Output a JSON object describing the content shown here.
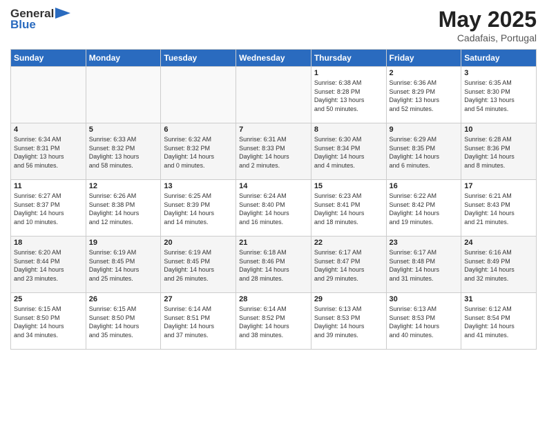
{
  "logo": {
    "general": "General",
    "blue": "Blue"
  },
  "title": "May 2025",
  "subtitle": "Cadafais, Portugal",
  "weekdays": [
    "Sunday",
    "Monday",
    "Tuesday",
    "Wednesday",
    "Thursday",
    "Friday",
    "Saturday"
  ],
  "weeks": [
    [
      {
        "day": "",
        "info": ""
      },
      {
        "day": "",
        "info": ""
      },
      {
        "day": "",
        "info": ""
      },
      {
        "day": "",
        "info": ""
      },
      {
        "day": "1",
        "info": "Sunrise: 6:38 AM\nSunset: 8:28 PM\nDaylight: 13 hours\nand 50 minutes."
      },
      {
        "day": "2",
        "info": "Sunrise: 6:36 AM\nSunset: 8:29 PM\nDaylight: 13 hours\nand 52 minutes."
      },
      {
        "day": "3",
        "info": "Sunrise: 6:35 AM\nSunset: 8:30 PM\nDaylight: 13 hours\nand 54 minutes."
      }
    ],
    [
      {
        "day": "4",
        "info": "Sunrise: 6:34 AM\nSunset: 8:31 PM\nDaylight: 13 hours\nand 56 minutes."
      },
      {
        "day": "5",
        "info": "Sunrise: 6:33 AM\nSunset: 8:32 PM\nDaylight: 13 hours\nand 58 minutes."
      },
      {
        "day": "6",
        "info": "Sunrise: 6:32 AM\nSunset: 8:32 PM\nDaylight: 14 hours\nand 0 minutes."
      },
      {
        "day": "7",
        "info": "Sunrise: 6:31 AM\nSunset: 8:33 PM\nDaylight: 14 hours\nand 2 minutes."
      },
      {
        "day": "8",
        "info": "Sunrise: 6:30 AM\nSunset: 8:34 PM\nDaylight: 14 hours\nand 4 minutes."
      },
      {
        "day": "9",
        "info": "Sunrise: 6:29 AM\nSunset: 8:35 PM\nDaylight: 14 hours\nand 6 minutes."
      },
      {
        "day": "10",
        "info": "Sunrise: 6:28 AM\nSunset: 8:36 PM\nDaylight: 14 hours\nand 8 minutes."
      }
    ],
    [
      {
        "day": "11",
        "info": "Sunrise: 6:27 AM\nSunset: 8:37 PM\nDaylight: 14 hours\nand 10 minutes."
      },
      {
        "day": "12",
        "info": "Sunrise: 6:26 AM\nSunset: 8:38 PM\nDaylight: 14 hours\nand 12 minutes."
      },
      {
        "day": "13",
        "info": "Sunrise: 6:25 AM\nSunset: 8:39 PM\nDaylight: 14 hours\nand 14 minutes."
      },
      {
        "day": "14",
        "info": "Sunrise: 6:24 AM\nSunset: 8:40 PM\nDaylight: 14 hours\nand 16 minutes."
      },
      {
        "day": "15",
        "info": "Sunrise: 6:23 AM\nSunset: 8:41 PM\nDaylight: 14 hours\nand 18 minutes."
      },
      {
        "day": "16",
        "info": "Sunrise: 6:22 AM\nSunset: 8:42 PM\nDaylight: 14 hours\nand 19 minutes."
      },
      {
        "day": "17",
        "info": "Sunrise: 6:21 AM\nSunset: 8:43 PM\nDaylight: 14 hours\nand 21 minutes."
      }
    ],
    [
      {
        "day": "18",
        "info": "Sunrise: 6:20 AM\nSunset: 8:44 PM\nDaylight: 14 hours\nand 23 minutes."
      },
      {
        "day": "19",
        "info": "Sunrise: 6:19 AM\nSunset: 8:45 PM\nDaylight: 14 hours\nand 25 minutes."
      },
      {
        "day": "20",
        "info": "Sunrise: 6:19 AM\nSunset: 8:45 PM\nDaylight: 14 hours\nand 26 minutes."
      },
      {
        "day": "21",
        "info": "Sunrise: 6:18 AM\nSunset: 8:46 PM\nDaylight: 14 hours\nand 28 minutes."
      },
      {
        "day": "22",
        "info": "Sunrise: 6:17 AM\nSunset: 8:47 PM\nDaylight: 14 hours\nand 29 minutes."
      },
      {
        "day": "23",
        "info": "Sunrise: 6:17 AM\nSunset: 8:48 PM\nDaylight: 14 hours\nand 31 minutes."
      },
      {
        "day": "24",
        "info": "Sunrise: 6:16 AM\nSunset: 8:49 PM\nDaylight: 14 hours\nand 32 minutes."
      }
    ],
    [
      {
        "day": "25",
        "info": "Sunrise: 6:15 AM\nSunset: 8:50 PM\nDaylight: 14 hours\nand 34 minutes."
      },
      {
        "day": "26",
        "info": "Sunrise: 6:15 AM\nSunset: 8:50 PM\nDaylight: 14 hours\nand 35 minutes."
      },
      {
        "day": "27",
        "info": "Sunrise: 6:14 AM\nSunset: 8:51 PM\nDaylight: 14 hours\nand 37 minutes."
      },
      {
        "day": "28",
        "info": "Sunrise: 6:14 AM\nSunset: 8:52 PM\nDaylight: 14 hours\nand 38 minutes."
      },
      {
        "day": "29",
        "info": "Sunrise: 6:13 AM\nSunset: 8:53 PM\nDaylight: 14 hours\nand 39 minutes."
      },
      {
        "day": "30",
        "info": "Sunrise: 6:13 AM\nSunset: 8:53 PM\nDaylight: 14 hours\nand 40 minutes."
      },
      {
        "day": "31",
        "info": "Sunrise: 6:12 AM\nSunset: 8:54 PM\nDaylight: 14 hours\nand 41 minutes."
      }
    ]
  ]
}
